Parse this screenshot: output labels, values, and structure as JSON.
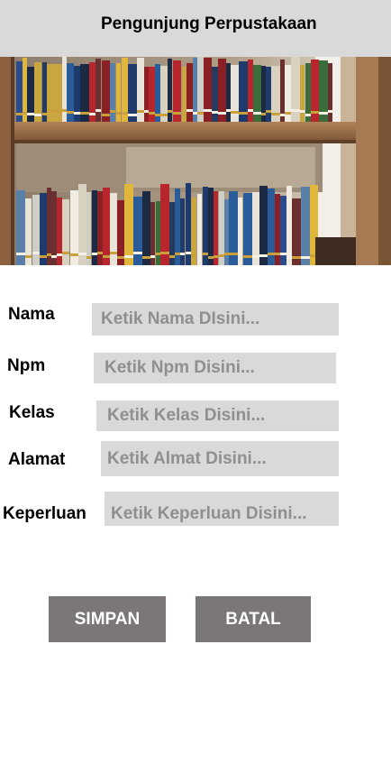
{
  "header": {
    "title": "Pengunjung Perpustakaan"
  },
  "hero": {
    "image": "bookshelf-photo"
  },
  "form": {
    "nama": {
      "label": "Nama",
      "placeholder": "Ketik Nama DIsini..."
    },
    "npm": {
      "label": "Npm",
      "placeholder": "Ketik Npm Disini..."
    },
    "kelas": {
      "label": "Kelas",
      "placeholder": "Ketik Kelas Disini..."
    },
    "alamat": {
      "label": "Alamat",
      "placeholder": "Ketik Almat Disini..."
    },
    "keperluan": {
      "label": "Keperluan",
      "placeholder": "Ketik Keperluan Disini..."
    }
  },
  "actions": {
    "simpan_label": "SIMPAN",
    "batal_label": "BATAL"
  },
  "colors": {
    "header_bg": "#d9d9d9",
    "field_bg": "#d9d9d9",
    "button_bg": "#7b7777",
    "button_text": "#ffffff"
  }
}
